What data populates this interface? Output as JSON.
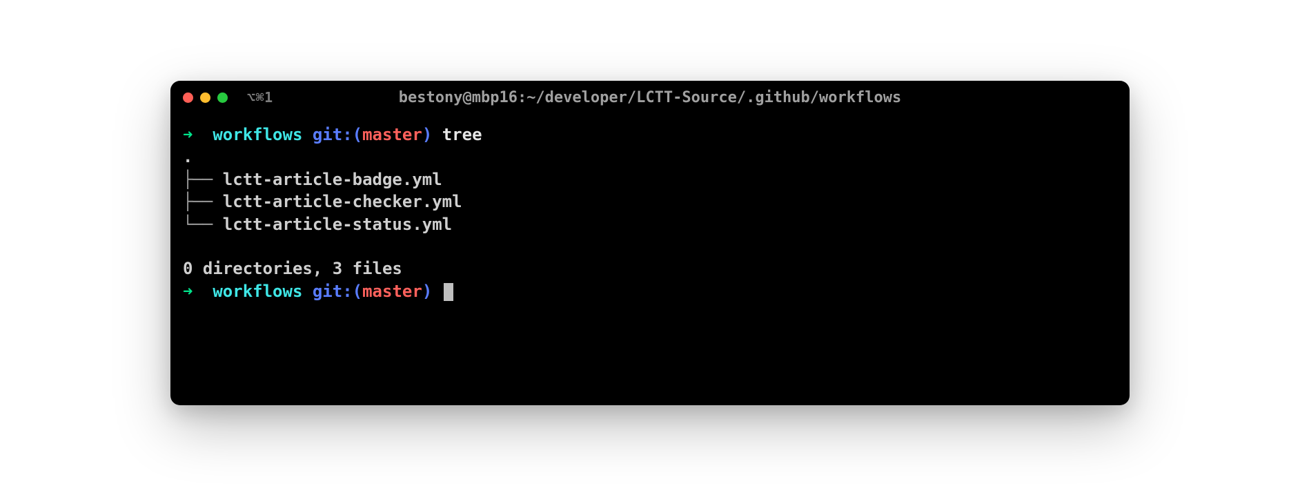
{
  "titlebar": {
    "tab_indicator": "⌥⌘1",
    "title": "bestony@mbp16:~/developer/LCTT-Source/.github/workflows"
  },
  "colors": {
    "arrow": "#00e38b",
    "dir": "#3fe6e6",
    "git": "#5a7dff",
    "branch": "#ff615c"
  },
  "prompt1": {
    "arrow": "➜",
    "dir": "workflows",
    "git_label": "git:",
    "paren_open": "(",
    "branch": "master",
    "paren_close": ")",
    "command": "tree"
  },
  "tree": {
    "root": ".",
    "entries": [
      {
        "prefix": "├── ",
        "name": "lctt-article-badge.yml"
      },
      {
        "prefix": "├── ",
        "name": "lctt-article-checker.yml"
      },
      {
        "prefix": "└── ",
        "name": "lctt-article-status.yml"
      }
    ],
    "summary": "0 directories, 3 files"
  },
  "prompt2": {
    "arrow": "➜",
    "dir": "workflows",
    "git_label": "git:",
    "paren_open": "(",
    "branch": "master",
    "paren_close": ")"
  }
}
